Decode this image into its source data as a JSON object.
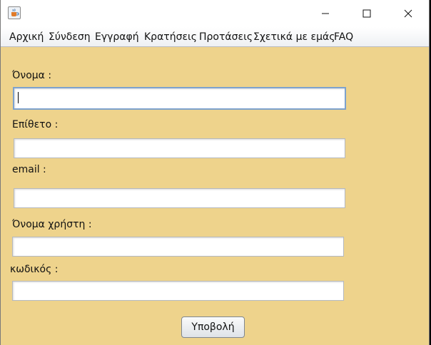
{
  "window": {
    "icon": "java-coffee-cup-icon"
  },
  "menu": {
    "items": [
      "Αρχική",
      "Σύνδεση",
      "Εγγραφή",
      "Κρατήσεις",
      "Προτάσεις",
      "Σχετικά με εμάς",
      "FAQ"
    ]
  },
  "form": {
    "first_name_label": "Όνομα :",
    "last_name_label": "Επίθετο :",
    "email_label": "email :",
    "username_label": "Όνομα χρήστη :",
    "password_label": "κωδικός :",
    "first_name_value": "",
    "last_name_value": "",
    "email_value": "",
    "username_value": "",
    "password_value": "",
    "submit_label": "Υποβολή"
  },
  "colors": {
    "background": "#eed38c",
    "focus_border": "#7da2ce"
  }
}
